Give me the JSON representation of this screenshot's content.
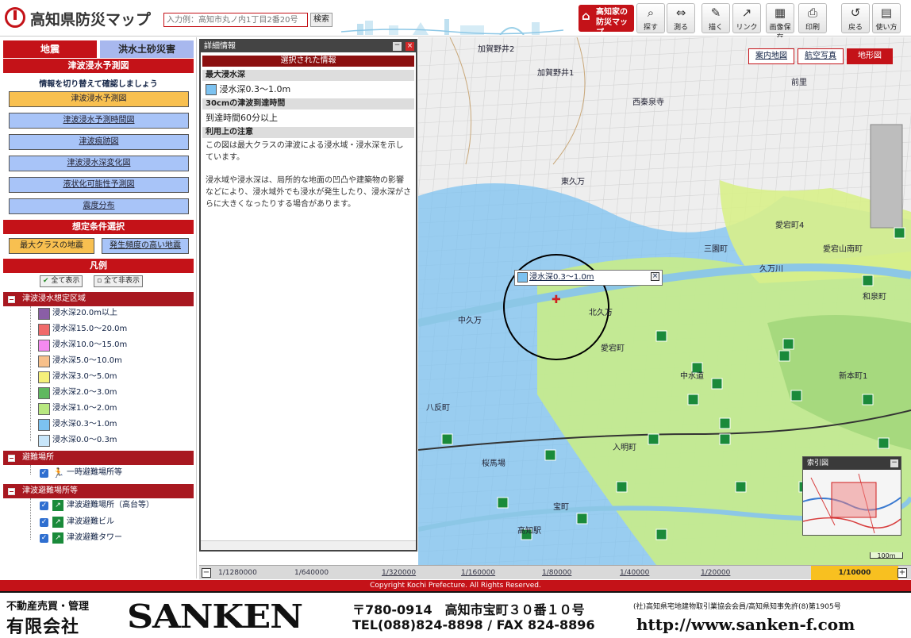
{
  "header": {
    "app_title": "高知県防災マップ",
    "search_placeholder": "入力例：高知市丸ノ内1丁目2番20号",
    "search_button": "検索",
    "home_button": "高知家の防災マップ",
    "tools": [
      "探す",
      "測る",
      "描く",
      "リンク",
      "画像保存",
      "印刷",
      "戻る",
      "使い方"
    ]
  },
  "left": {
    "tabs": [
      "地震",
      "洪水土砂災害"
    ],
    "section_title": "津波浸水予測図",
    "info_text": "情報を切り替えて確認しましょう",
    "maps": [
      "津波浸水予測図",
      "津波浸水予測時間図",
      "津波痕跡図",
      "津波浸水深変化図",
      "液状化可能性予測図",
      "震度分布"
    ],
    "condition_title": "想定条件選択",
    "conditions": [
      "最大クラスの地震",
      "発生頻度の高い地震"
    ],
    "legend_title": "凡例",
    "show_all": "全て表示",
    "hide_all": "全て非表示",
    "group_inundation": "津波浸水想定区域",
    "depths": [
      {
        "label": "浸水深20.0m以上",
        "color": "#8a5ea6"
      },
      {
        "label": "浸水深15.0〜20.0m",
        "color": "#f06a6a"
      },
      {
        "label": "浸水深10.0〜15.0m",
        "color": "#f58af0"
      },
      {
        "label": "浸水深5.0〜10.0m",
        "color": "#f7c08a"
      },
      {
        "label": "浸水深3.0〜5.0m",
        "color": "#f5f07a"
      },
      {
        "label": "浸水深2.0〜3.0m",
        "color": "#5fb85f"
      },
      {
        "label": "浸水深1.0〜2.0m",
        "color": "#b8e880"
      },
      {
        "label": "浸水深0.3〜1.0m",
        "color": "#7cc2f0"
      },
      {
        "label": "浸水深0.0〜0.3m",
        "color": "#c8e6fa"
      }
    ],
    "group_shelter": "避難場所",
    "shelter_item": "一時避難場所等",
    "group_tsunami": "津波避難場所等",
    "tsunami_items": [
      "津波避難場所（高台等）",
      "津波避難ビル",
      "津波避難タワー"
    ]
  },
  "panel": {
    "title": "詳細情報",
    "selected": "選択された情報",
    "depth_label": "最大浸水深",
    "depth_value": "浸水深0.3〜1.0m",
    "time_label": "30cmの津波到達時間",
    "time_value": "到達時間60分以上",
    "note_label": "利用上の注意",
    "note1": "この図は最大クラスの津波による浸水域・浸水深を示しています。",
    "note2": "浸水域や浸水深は、局所的な地面の凹凸や建築物の影響などにより、浸水域外でも浸水が発生したり、浸水深がさらに大きくなったりする場合があります。"
  },
  "map": {
    "tabs": [
      "案内地図",
      "航空写真",
      "地形図"
    ],
    "popup_text": "浸水深0.3〜1.0m",
    "overview_title": "索引図",
    "scale_label": "100m",
    "place_names": [
      "加賀野井2",
      "加賀野井1",
      "西秦泉寺",
      "前里",
      "東久万",
      "北久万",
      "三園町",
      "愛宕町4",
      "愛宕山南町",
      "久万川",
      "和泉町",
      "中久万",
      "愛宕町",
      "中水道",
      "新本町1",
      "八反町",
      "入明町",
      "宝町",
      "桜馬場",
      "高知駅"
    ]
  },
  "zoom": [
    "1/1280000",
    "1/640000",
    "1/320000",
    "1/160000",
    "1/80000",
    "1/40000",
    "1/20000",
    "1/10000"
  ],
  "copyright": "Copyright Kochi Prefecture. All Rights Reserved.",
  "ad": {
    "line1": "不動産売買・管理",
    "line2": "有限会社",
    "brand": "SANKEN",
    "address": "〒780-0914　高知市宝町３０番１０号",
    "tel": "TEL(088)824-8898 / FAX 824-8896",
    "assoc": "(社)高知県宅地建物取引業協会会員/高知県知事免許(8)第1905号",
    "url": "http://www.sanken-f.com"
  }
}
